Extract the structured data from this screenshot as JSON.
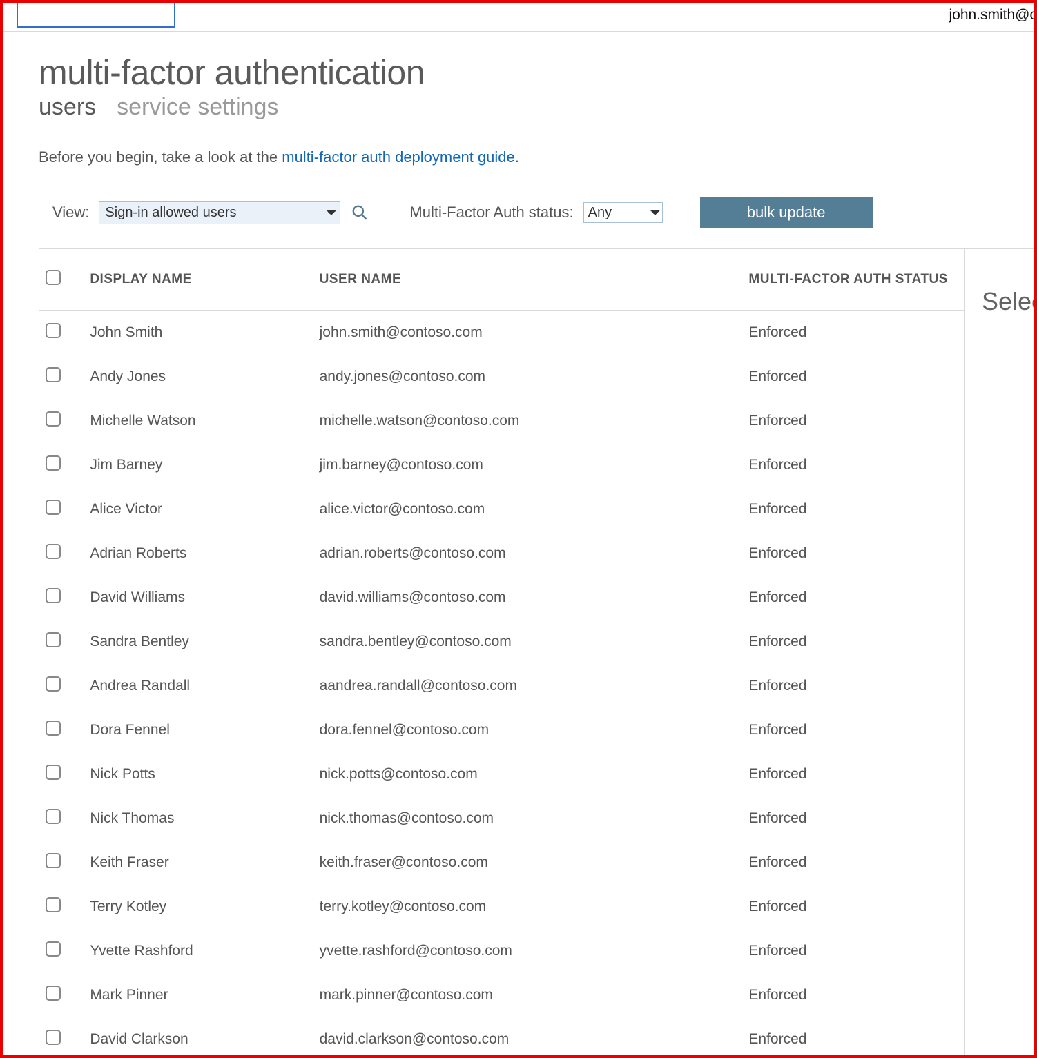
{
  "header": {
    "user_email_partial": "john.smith@c"
  },
  "page": {
    "title": "multi-factor authentication",
    "tabs": [
      {
        "label": "users",
        "active": true
      },
      {
        "label": "service settings",
        "active": false
      }
    ],
    "intro_prefix": "Before you begin, take a look at the ",
    "intro_link": "multi-factor auth deployment guide",
    "intro_suffix": "."
  },
  "filters": {
    "view_label": "View:",
    "view_value": "Sign-in allowed users",
    "status_label": "Multi-Factor Auth status:",
    "status_value": "Any",
    "bulk_update_label": "bulk update"
  },
  "columns": {
    "display_name": "DISPLAY NAME",
    "user_name": "USER NAME",
    "mfa_status": "MULTI-FACTOR AUTH STATUS"
  },
  "side_panel": {
    "title": "Select"
  },
  "users": [
    {
      "display_name": "John Smith",
      "user_name": "john.smith@contoso.com",
      "status": "Enforced"
    },
    {
      "display_name": "Andy Jones",
      "user_name": "andy.jones@contoso.com",
      "status": "Enforced"
    },
    {
      "display_name": "Michelle Watson",
      "user_name": "michelle.watson@contoso.com",
      "status": "Enforced"
    },
    {
      "display_name": "Jim Barney",
      "user_name": "jim.barney@contoso.com",
      "status": "Enforced"
    },
    {
      "display_name": "Alice Victor",
      "user_name": "alice.victor@contoso.com",
      "status": "Enforced"
    },
    {
      "display_name": "Adrian Roberts",
      "user_name": "adrian.roberts@contoso.com",
      "status": "Enforced"
    },
    {
      "display_name": "David Williams",
      "user_name": "david.williams@contoso.com",
      "status": "Enforced"
    },
    {
      "display_name": "Sandra Bentley",
      "user_name": "sandra.bentley@contoso.com",
      "status": "Enforced"
    },
    {
      "display_name": "Andrea Randall",
      "user_name": "aandrea.randall@contoso.com",
      "status": "Enforced"
    },
    {
      "display_name": "Dora Fennel",
      "user_name": "dora.fennel@contoso.com",
      "status": "Enforced"
    },
    {
      "display_name": "Nick Potts",
      "user_name": "nick.potts@contoso.com",
      "status": "Enforced"
    },
    {
      "display_name": "Nick Thomas",
      "user_name": "nick.thomas@contoso.com",
      "status": "Enforced"
    },
    {
      "display_name": "Keith Fraser",
      "user_name": "keith.fraser@contoso.com",
      "status": "Enforced"
    },
    {
      "display_name": "Terry Kotley",
      "user_name": "terry.kotley@contoso.com",
      "status": "Enforced"
    },
    {
      "display_name": "Yvette Rashford",
      "user_name": "yvette.rashford@contoso.com",
      "status": "Enforced"
    },
    {
      "display_name": "Mark Pinner",
      "user_name": "mark.pinner@contoso.com",
      "status": "Enforced"
    },
    {
      "display_name": "David Clarkson",
      "user_name": "david.clarkson@contoso.com",
      "status": "Enforced"
    }
  ]
}
